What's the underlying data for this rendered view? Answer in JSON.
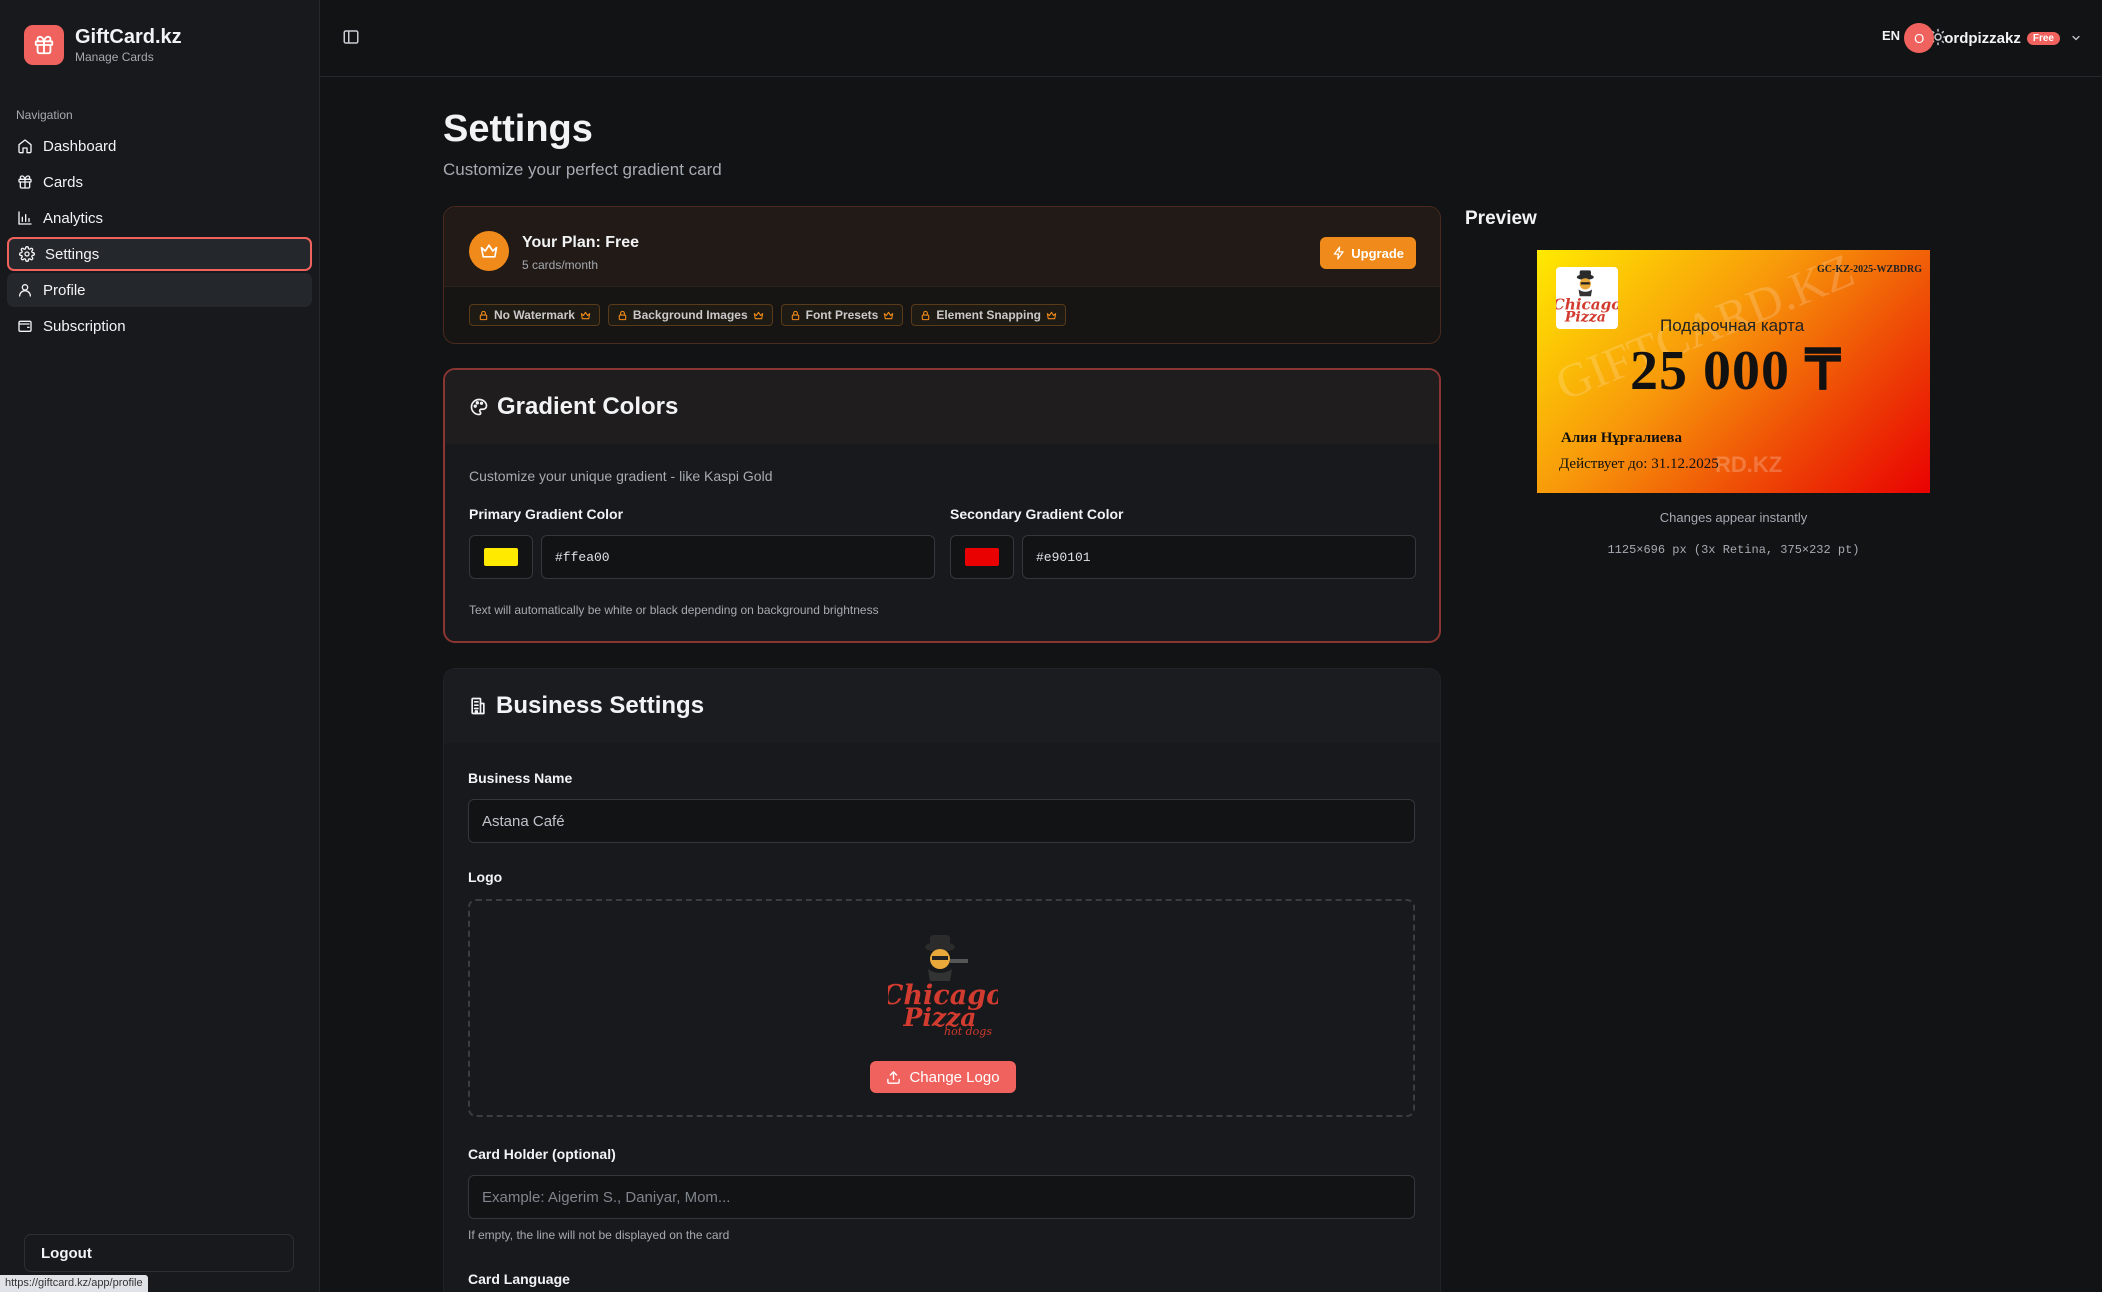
{
  "brand": {
    "title": "GiftCard.kz",
    "subtitle": "Manage Cards"
  },
  "sidebar": {
    "heading": "Navigation",
    "items": [
      {
        "label": "Dashboard",
        "icon": "home-icon"
      },
      {
        "label": "Cards",
        "icon": "gift-icon"
      },
      {
        "label": "Analytics",
        "icon": "bar-chart-icon"
      },
      {
        "label": "Settings",
        "icon": "gear-icon",
        "active": true
      },
      {
        "label": "Profile",
        "icon": "user-icon"
      },
      {
        "label": "Subscription",
        "icon": "wallet-icon"
      }
    ],
    "logout": "Logout"
  },
  "status_url": "https://giftcard.kz/app/profile",
  "topbar": {
    "lang": "EN",
    "avatar_initial": "O",
    "username": "ordpizzakz",
    "plan_badge": "Free"
  },
  "page": {
    "title": "Settings",
    "subtitle": "Customize your perfect gradient card"
  },
  "plan": {
    "title": "Your Plan: Free",
    "subtitle": "5 cards/month",
    "upgrade": "Upgrade",
    "features": [
      "No Watermark",
      "Background Images",
      "Font Presets",
      "Element Snapping"
    ]
  },
  "gradient": {
    "title": "Gradient Colors",
    "description": "Customize your unique gradient - like Kaspi Gold",
    "primary_label": "Primary Gradient Color",
    "primary_value": "#ffea00",
    "secondary_label": "Secondary Gradient Color",
    "secondary_value": "#e90101",
    "hint": "Text will automatically be white or black depending on background brightness"
  },
  "business": {
    "title": "Business Settings",
    "name_label": "Business Name",
    "name_value": "Astana Café",
    "logo_label": "Logo",
    "change_logo": "Change Logo",
    "holder_label": "Card Holder (optional)",
    "holder_placeholder": "Example: Aigerim S., Daniyar, Mom...",
    "holder_hint": "If empty, the line will not be displayed on the card",
    "language_label": "Card Language"
  },
  "preview": {
    "title": "Preview",
    "card_code": "GC-KZ-2025-WZBDRG",
    "card_label": "Подарочная карта",
    "card_amount": "25 000 ₸",
    "card_holder": "Алия Нұрғалиева",
    "card_valid": "Действует до: 31.12.2025",
    "watermark": "GIFTCARD.KZ",
    "note": "Changes appear instantly",
    "dims": "1125×696 px (3x Retina, 375×232 pt)"
  },
  "logo_text": "Chicago Pizza hot dogs",
  "colors": {
    "accent": "#f0625d",
    "orange": "#f08a1a",
    "primary_gradient": "#ffea00",
    "secondary_gradient": "#e90101"
  }
}
